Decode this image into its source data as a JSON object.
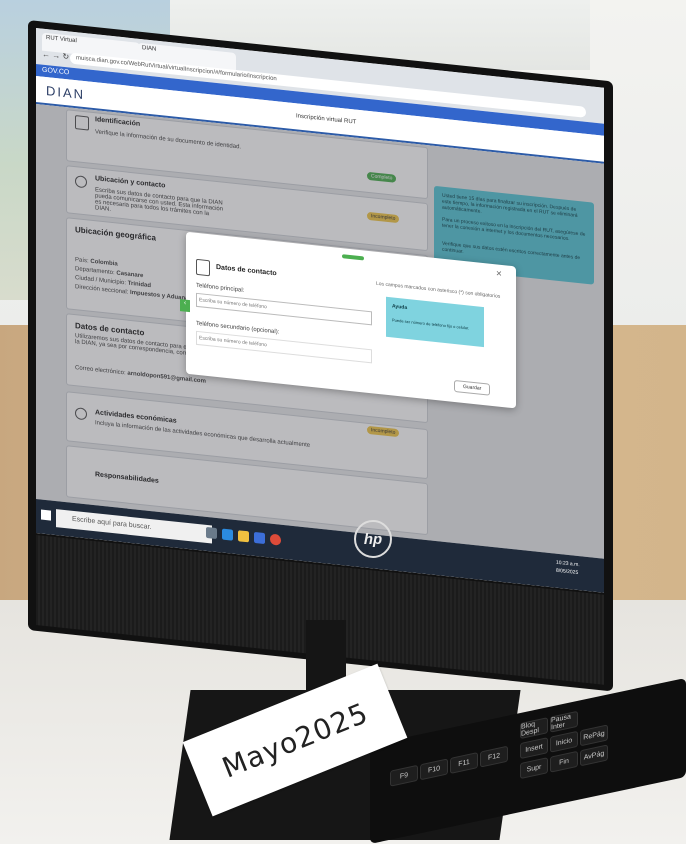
{
  "browser": {
    "tab1": "RUT Virtual",
    "tab2": "DIAN",
    "url": "muisca.dian.gov.co/WebRutVirtual/virtualInscripcion/#/formulario/inscripcion"
  },
  "gov_bar": "GOV.CO",
  "site_logo": "DIAN",
  "page_heading": "Inscripción virtual RUT",
  "sections": {
    "identificacion": {
      "title": "Identificación",
      "text": "Verifique la información de su documento de identidad.",
      "badge": "Completo"
    },
    "ubicacion": {
      "title": "Ubicación y contacto",
      "text": "Escriba sus datos de contacto para que la DIAN pueda comunicarse con usted. Esta información es necesaria para todos los trámites con la DIAN.",
      "badge": "Incompleto"
    },
    "ubicacion_geografica": {
      "title": "Ubicación geográfica",
      "pais_label": "País:",
      "pais": "Colombia",
      "depto_label": "Departamento:",
      "depto": "Casanare",
      "ciudad_label": "Ciudad / Municipio:",
      "ciudad": "Trinidad",
      "direccion_label": "Dirección seccional:",
      "direccion": "Impuestos y Aduanas"
    },
    "datos_contacto": {
      "title": "Datos de contacto",
      "text": "Utilizaremos sus datos de contacto para enviarle información relevante de la DIAN, ya sea por correspondencia, correo electrónico...",
      "email_label": "Correo electrónico:",
      "email": "arnoldopon591@gmail.com"
    },
    "actividades": {
      "title": "Actividades económicas",
      "text": "Incluya la información de las actividades económicas que desarrolla actualmente",
      "badge": "Incompleto"
    },
    "responsabilidades": {
      "title": "Responsabilidades"
    }
  },
  "info_box": {
    "items": [
      "Usted tiene 15 días para finalizar su inscripción. Después de este tiempo, la información registrada en el RUT se eliminará automáticamente.",
      "Para un proceso exitoso en la inscripción del RUT, asegúrese de tener la conexión a internet y los documentos necesarios.",
      "Verifique que sus datos estén escritos correctamente antes de continuar."
    ]
  },
  "modal": {
    "title": "Datos de contacto",
    "required_note": "Los campos marcados con asterisco (*) son obligatorios",
    "phone_label": "Teléfono principal:",
    "phone_placeholder": "Escriba su número de teléfono",
    "phone2_label": "Teléfono secundario (opcional):",
    "phone2_placeholder": "Escriba su número de teléfono",
    "save_button": "Guardar",
    "close": "×",
    "help_title": "Ayuda",
    "help_item": "Puede ser número de teléfono fijo o celular."
  },
  "taskbar": {
    "search_placeholder": "Escribe aquí para buscar.",
    "time": "10:23 a.m.",
    "date": "8/05/2025"
  },
  "monitor_brand": "hp",
  "paper_label": "Mayo2025",
  "keyboard": [
    "Insert",
    "Inicio",
    "RePág",
    "Supr",
    "Fin",
    "AvPág",
    "Bloq Despl",
    "Pausa Inter",
    "F9",
    "F10",
    "F11",
    "F12"
  ]
}
